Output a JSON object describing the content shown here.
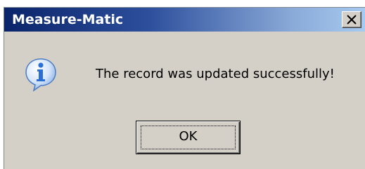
{
  "dialog": {
    "title": "Measure-Matic",
    "message": "The record was updated successfully!",
    "ok_label": "OK",
    "icon": "information-icon",
    "close_icon": "close-icon"
  },
  "colors": {
    "titlebar_start": "#0a246a",
    "titlebar_end": "#a6caf0",
    "face": "#d4d0c8",
    "icon_blue": "#2a6fd6"
  }
}
